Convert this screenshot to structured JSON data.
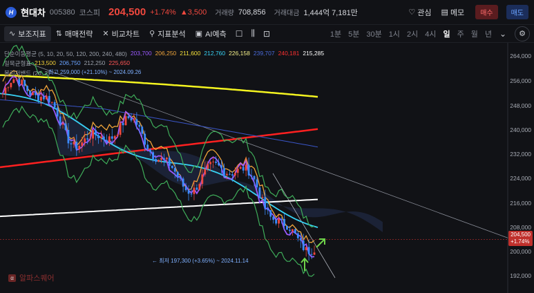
{
  "header": {
    "logo": "H",
    "name": "현대차",
    "code": "005380",
    "market": "코스피",
    "price": "204,500",
    "change_pct": "+1.74%",
    "change_amt": "▲3,500",
    "volume_label": "거래량",
    "volume": "708,856",
    "amount_label": "거래대금",
    "amount": "1,444억 7,181만",
    "favorite": "관심",
    "memo": "메모",
    "buy": "매수",
    "sell": "매도"
  },
  "toolbar": {
    "tools": [
      "보조지표",
      "매매전략",
      "비교차트",
      "지표분석",
      "AI예측"
    ],
    "timeframes": [
      "1분",
      "5분",
      "30분",
      "1시",
      "2시",
      "4시",
      "일",
      "주",
      "월",
      "년"
    ],
    "active_timeframe": "일"
  },
  "legend": {
    "sma": {
      "name": "단순이동평균 (5, 10, 20, 50, 120, 200, 240, 480)",
      "values": [
        "203,700",
        "206,250",
        "211,600",
        "212,760",
        "226,158",
        "239,707",
        "240,181",
        "215,285"
      ]
    },
    "ichimoku": {
      "name": "일목균형표",
      "values": [
        "213,500",
        "206,750",
        "212,250",
        "225,650"
      ]
    },
    "bollinger": {
      "name": "볼린저밴드 (20, 2)"
    }
  },
  "colors": {
    "sma": [
      "#9b59ff",
      "#f0a53a",
      "#f5e13a",
      "#38d3f5",
      "#f5f08a",
      "#4a6bdc",
      "#ff3030",
      "#ffffff"
    ],
    "ichimoku": [
      "#f5d23a",
      "#6aa3ff",
      "#ff5555",
      "#4ac06a"
    ],
    "up": "#f0483e",
    "down": "#3b8cff"
  },
  "yaxis": [
    "264,000",
    "256,000",
    "248,000",
    "240,000",
    "232,000",
    "224,000",
    "216,000",
    "208,000",
    "200,000",
    "192,000"
  ],
  "price_tag": {
    "price": "204,500",
    "pct": "+1.74%"
  },
  "annotations": {
    "high": "최고 259,000 (+21.10%) ~ 2024.09.26",
    "low": "← 최저 197,300 (+3.65%) ~ 2024.11.14"
  },
  "watermark": "알파스퀘어"
}
